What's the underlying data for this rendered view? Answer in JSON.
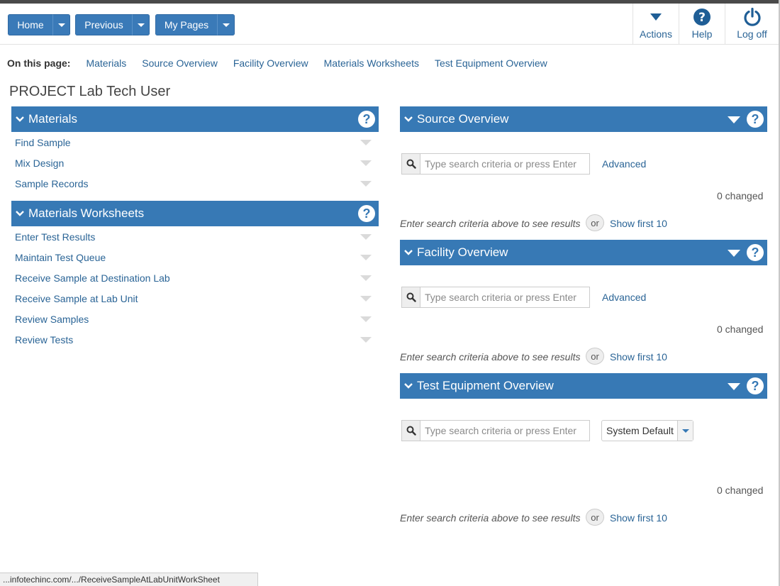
{
  "header": {
    "nav_buttons": [
      {
        "label": "Home"
      },
      {
        "label": "Previous"
      },
      {
        "label": "My Pages"
      }
    ],
    "tools": [
      {
        "label": "Actions",
        "icon": "actions-caret-icon"
      },
      {
        "label": "Help",
        "icon": "help-icon"
      },
      {
        "label": "Log off",
        "icon": "power-icon"
      }
    ]
  },
  "on_this_page": {
    "title": "On this page:",
    "links": [
      "Materials",
      "Source Overview",
      "Facility Overview",
      "Materials Worksheets",
      "Test Equipment Overview"
    ]
  },
  "page_title": "PROJECT Lab Tech User",
  "left_panels": [
    {
      "title": "Materials",
      "items": [
        "Find Sample",
        "Mix Design",
        "Sample Records"
      ]
    },
    {
      "title": "Materials Worksheets",
      "items": [
        "Enter Test Results",
        "Maintain Test Queue",
        "Receive Sample at Destination Lab",
        "Receive Sample at Lab Unit",
        "Review Samples",
        "Review Tests"
      ]
    }
  ],
  "right_panels": [
    {
      "title": "Source Overview",
      "search_placeholder": "Type search criteria or press Enter",
      "advanced_label": "Advanced",
      "changed_text": "0 changed",
      "hint_text": "Enter search criteria above to see results",
      "or_label": "or",
      "show_label": "Show first 10"
    },
    {
      "title": "Facility Overview",
      "search_placeholder": "Type search criteria or press Enter",
      "advanced_label": "Advanced",
      "changed_text": "0 changed",
      "hint_text": "Enter search criteria above to see results",
      "or_label": "or",
      "show_label": "Show first 10"
    },
    {
      "title": "Test Equipment Overview",
      "search_placeholder": "Type search criteria or press Enter",
      "select_value": "System Default",
      "changed_text": "0 changed",
      "hint_text": "Enter search criteria above to see results",
      "or_label": "or",
      "show_label": "Show first 10"
    }
  ],
  "status_bar": "...infotechinc.com/.../ReceiveSampleAtLabUnitWorkSheet",
  "colors": {
    "accent": "#3779b5",
    "link": "#2a6496"
  }
}
